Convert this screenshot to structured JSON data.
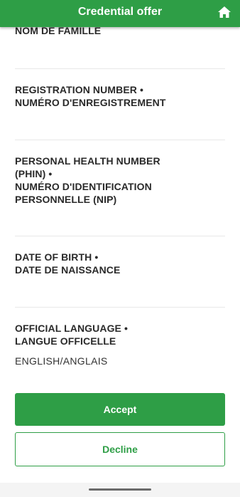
{
  "header": {
    "title": "Credential offer",
    "home_icon": "home-icon",
    "color": "#2e9e46"
  },
  "fields": {
    "family_name": {
      "label": "NOM DE FAMILLE"
    },
    "registration": {
      "label_en": "REGISTRATION NUMBER •",
      "label_fr": "NUMÉRO D'ENREGISTREMENT"
    },
    "phin": {
      "label_line1": "PERSONAL HEALTH NUMBER",
      "label_line2": "(PHIN) •",
      "label_line3": "NUMÉRO D'IDENTIFICATION",
      "label_line4": "PERSONNELLE (NIP)"
    },
    "dob": {
      "label_en": "DATE OF BIRTH •",
      "label_fr": "DATE DE NAISSANCE"
    },
    "language": {
      "label_en": "OFFICIAL LANGUAGE •",
      "label_fr": "LANGUE OFFICELLE",
      "value": "ENGLISH/ANGLAIS"
    }
  },
  "actions": {
    "accept_label": "Accept",
    "decline_label": "Decline"
  }
}
